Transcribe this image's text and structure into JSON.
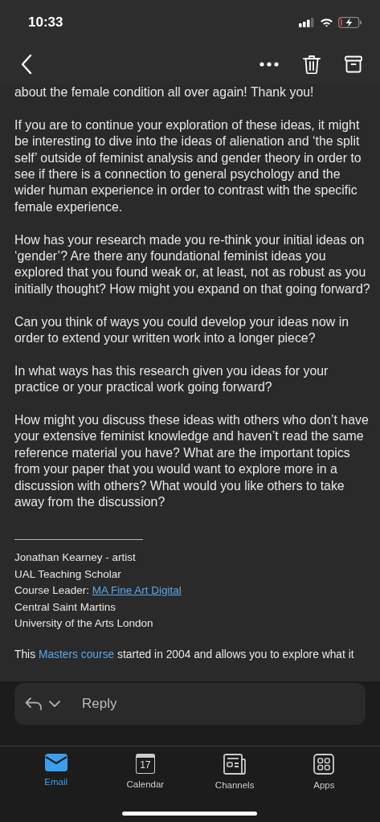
{
  "status_bar": {
    "time": "10:33"
  },
  "message": {
    "paragraphs": [
      "about the female condition all over again! Thank you!",
      "If you are to continue your exploration of these ideas, it might be interesting to dive into the ideas of alienation and ‘the split self’ outside of feminist analysis and gender theory in order to see if there is a connection to general psychology and the wider human experience in order to contrast with the specific female experience.",
      "How has your research made you re-think your initial ideas on ‘gender’? Are there any foundational feminist ideas you explored that you found weak or, at least, not as robust as you initially thought? How might you expand on that going forward?",
      "Can you think of ways you could develop your ideas now in order to extend your written work into a longer piece?",
      "In what ways has this research given you ideas for your practice or your practical work going forward?",
      "How might you discuss these ideas with others who don’t have your extensive feminist knowledge and haven’t read the same reference material you have? What are the important topics from your paper that you would want to explore more in a discussion with others? What would you like others to take away from the discussion?"
    ],
    "signature": [
      {
        "text": "Jonathan Kearney - artist"
      },
      {
        "text": "UAL Teaching Scholar"
      },
      {
        "text": "Course Leader: ",
        "link": "MA Fine Art Digital"
      },
      {
        "text": "Central Saint Martins"
      },
      {
        "text": "University of the Arts London"
      }
    ],
    "footer": {
      "before": "This ",
      "link": "Masters course",
      "after": " started in 2004 and allows you to explore what it"
    }
  },
  "reply": {
    "placeholder": "Reply"
  },
  "tabs": [
    {
      "label": "Email",
      "selected": true
    },
    {
      "label": "Calendar",
      "selected": false,
      "day": "17"
    },
    {
      "label": "Channels",
      "selected": false
    },
    {
      "label": "Apps",
      "selected": false
    }
  ]
}
